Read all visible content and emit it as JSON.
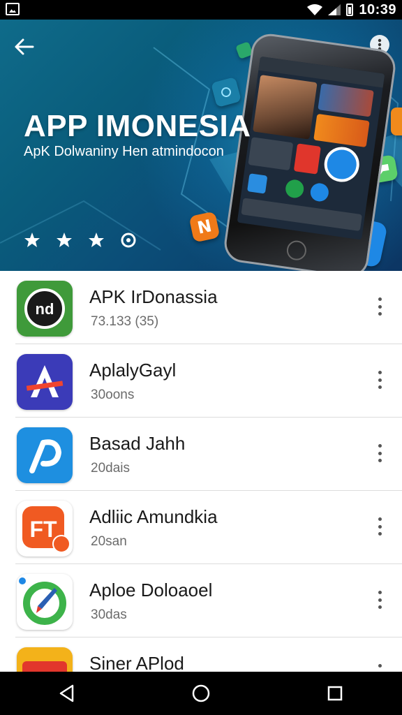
{
  "status_bar": {
    "time": "10:39"
  },
  "hero": {
    "title": "APP IMONESIA",
    "subtitle": "ApK Dolwaniny Hen atmindocon",
    "rating_icons": [
      "star-icon",
      "star-icon",
      "star-icon",
      "info-circle-icon"
    ],
    "float_icon_letter": "N"
  },
  "apps": [
    {
      "name": "APK IrDonassia",
      "meta": "73.133 (35)",
      "icon": "nd-logo-icon",
      "icon_bg": "#3f9a3a"
    },
    {
      "name": "AplalyGayl",
      "meta": "30oons",
      "icon": "a-letter-icon",
      "icon_bg": "#3b3bb8"
    },
    {
      "name": "Basad Jahh",
      "meta": "20dais",
      "icon": "p-logo-icon",
      "icon_bg": "#1e8fe0"
    },
    {
      "name": "Adliic Amundkia",
      "meta": "20san",
      "icon": "ft-logo-icon",
      "icon_bg": "#f05a22",
      "icon_text": "FT"
    },
    {
      "name": "Aploe Doloaoel",
      "meta": "30das",
      "icon": "compass-icon",
      "icon_bg": "#ffffff"
    },
    {
      "name": "Siner APlod",
      "meta": "",
      "icon": "red-yellow-app-icon",
      "icon_bg": "#f3b21a"
    }
  ],
  "colors": {
    "hero_dark": "#0b4e78",
    "hero_light": "#28bee6",
    "divider": "#dcdcdc"
  }
}
